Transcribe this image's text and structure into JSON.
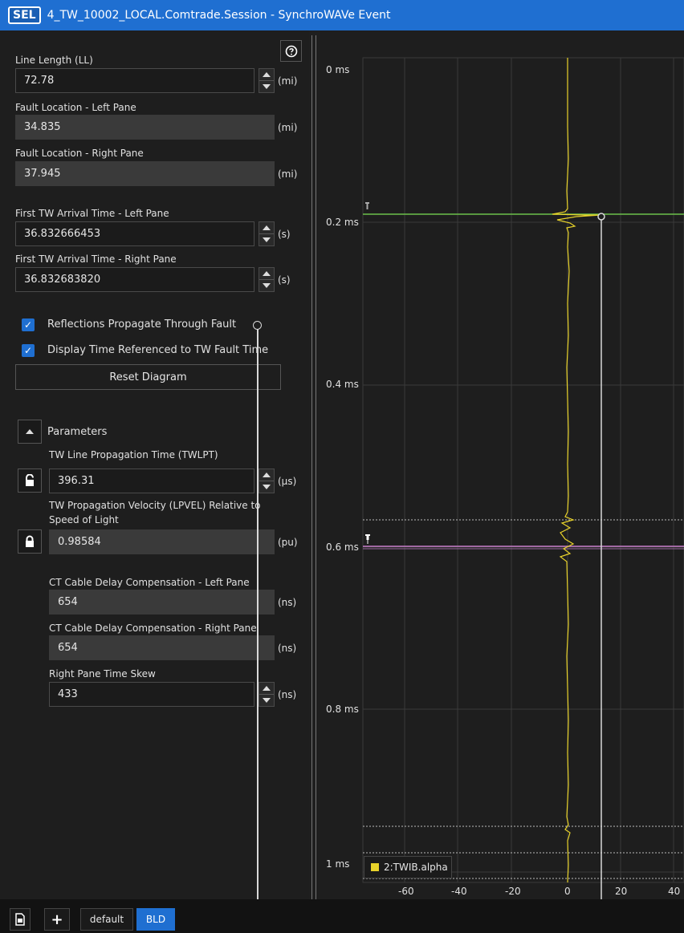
{
  "window": {
    "logo": "SEL",
    "title": "4_TW_10002_LOCAL.Comtrade.Session - SynchroWAVe Event"
  },
  "form": {
    "line_length": {
      "label": "Line Length (LL)",
      "value": "72.78",
      "unit": "(mi)"
    },
    "fault_left": {
      "label": "Fault Location - Left Pane",
      "value": "34.835",
      "unit": "(mi)"
    },
    "fault_right": {
      "label": "Fault Location - Right Pane",
      "value": "37.945",
      "unit": "(mi)"
    },
    "arrival_left": {
      "label": "First TW Arrival Time - Left Pane",
      "value": "36.832666453",
      "unit": "(s)"
    },
    "arrival_right": {
      "label": "First TW Arrival Time - Right Pane",
      "value": "36.832683820",
      "unit": "(s)"
    },
    "reflections": {
      "label": "Reflections Propagate Through Fault",
      "checked": true
    },
    "display_time": {
      "label": "Display Time Referenced to TW Fault Time",
      "checked": true
    },
    "reset_label": "Reset Diagram",
    "parameters_label": "Parameters",
    "twlpt": {
      "label": "TW Line Propagation Time (TWLPT)",
      "value": "396.31",
      "unit": "(μs)"
    },
    "lpvel": {
      "label_line1": "TW Propagation Velocity (LPVEL) Relative to",
      "label_line2": "Speed of Light",
      "value": "0.98584",
      "unit": "(pu)"
    },
    "ct_left": {
      "label": "CT Cable Delay Compensation - Left Pane",
      "value": "654",
      "unit": "(ns)"
    },
    "ct_right": {
      "label": "CT Cable Delay Compensation - Right Pane",
      "value": "654",
      "unit": "(ns)"
    },
    "skew": {
      "label": "Right Pane Time Skew",
      "value": "433",
      "unit": "(ns)"
    }
  },
  "chart": {
    "y_ticks": [
      "0 ms",
      "0.2 ms",
      "0.4 ms",
      "0.6 ms",
      "0.8 ms",
      "1 ms"
    ],
    "x_ticks": [
      "-60",
      "-40",
      "-20",
      "0",
      "20",
      "40"
    ],
    "legend": "2:TWIB.alpha",
    "colors": {
      "signal": "#e8d22a",
      "green_marker": "#6cc04a",
      "magenta_marker": "#c77dc9",
      "grid": "#3a3a3a"
    }
  },
  "bottom": {
    "tabs": [
      "default",
      "BLD"
    ],
    "active_tab": "BLD"
  }
}
